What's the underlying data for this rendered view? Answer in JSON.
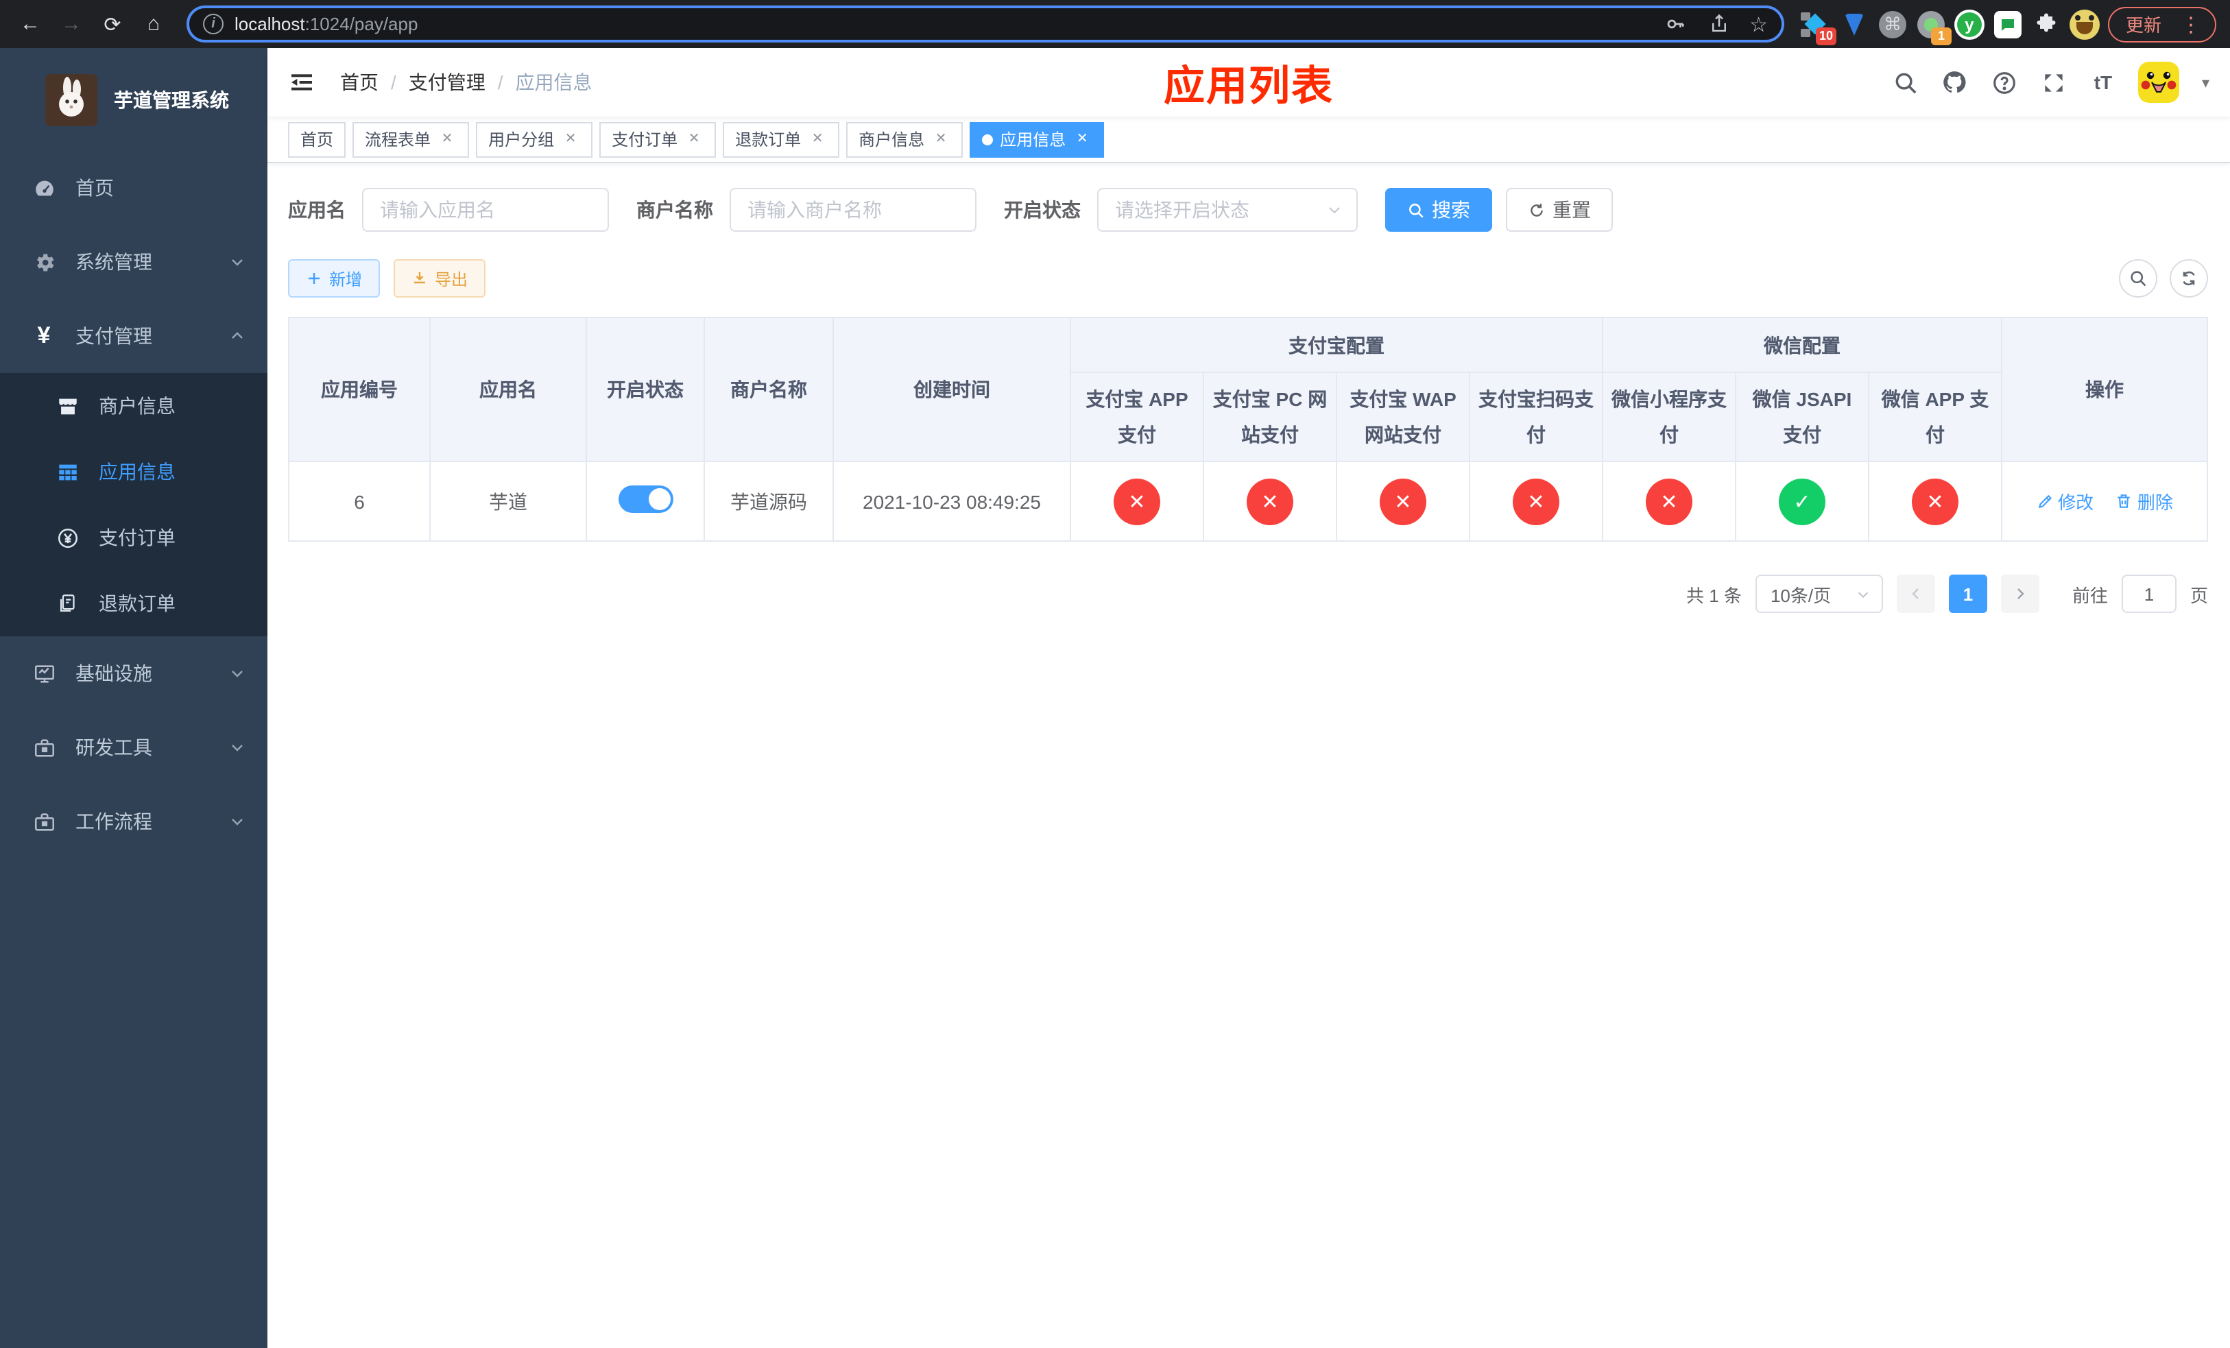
{
  "colors": {
    "primary": "#409eff",
    "success": "#13ce66",
    "danger": "#f8413d",
    "warning": "#e6a23c",
    "sidebar_bg": "#304156",
    "submenu_bg": "#1f2d3d",
    "page_title_red": "#ff2b00",
    "browser_bg": "#202124"
  },
  "icons": {
    "close": "✕",
    "check": "✓",
    "back": "←",
    "forward": "→",
    "reload": "⟳",
    "home": "⌂",
    "command": "⌘",
    "star": "☆",
    "menu_dots": "⋮",
    "caret_down": "▾",
    "font_size": "tT",
    "question": "?",
    "ext_y": "y"
  },
  "browser": {
    "url_host": "localhost",
    "url_path": ":1024/pay/app",
    "update_label": "更新",
    "ext_badges": [
      "10",
      "1"
    ]
  },
  "sidebar": {
    "title": "芋道管理系统",
    "items": [
      {
        "label": "首页"
      },
      {
        "label": "系统管理"
      },
      {
        "label": "支付管理"
      },
      {
        "label": "基础设施"
      },
      {
        "label": "研发工具"
      },
      {
        "label": "工作流程"
      }
    ],
    "submenu": [
      {
        "label": "商户信息"
      },
      {
        "label": "应用信息"
      },
      {
        "label": "支付订单"
      },
      {
        "label": "退款订单"
      }
    ]
  },
  "navbar": {
    "breadcrumb": [
      "首页",
      "支付管理",
      "应用信息"
    ],
    "page_title": "应用列表"
  },
  "tabs": [
    {
      "label": "首页"
    },
    {
      "label": "流程表单"
    },
    {
      "label": "用户分组"
    },
    {
      "label": "支付订单"
    },
    {
      "label": "退款订单"
    },
    {
      "label": "商户信息"
    },
    {
      "label": "应用信息"
    }
  ],
  "filter": {
    "app_name_label": "应用名",
    "app_name_placeholder": "请输入应用名",
    "merchant_label": "商户名称",
    "merchant_placeholder": "请输入商户名称",
    "status_label": "开启状态",
    "status_placeholder": "请选择开启状态",
    "search_label": "搜索",
    "reset_label": "重置"
  },
  "toolbar": {
    "add_label": "新增",
    "export_label": "导出"
  },
  "table": {
    "columns": [
      "应用编号",
      "应用名",
      "开启状态",
      "商户名称",
      "创建时间"
    ],
    "groups": [
      "支付宝配置",
      "微信配置"
    ],
    "channel_columns": [
      "支付宝 APP 支付",
      "支付宝 PC 网站支付",
      "支付宝 WAP 网站支付",
      "支付宝扫码支付",
      "微信小程序支付",
      "微信 JSAPI 支付",
      "微信 APP 支付"
    ],
    "actions_column": "操作",
    "row": {
      "id": "6",
      "name": "芋道",
      "enabled": true,
      "merchant": "芋道源码",
      "created_at": "2021-10-23 08:49:25",
      "channels": [
        false,
        false,
        false,
        false,
        false,
        true,
        false
      ],
      "edit_label": "修改",
      "delete_label": "删除"
    }
  },
  "pagination": {
    "total": "共 1 条",
    "page_size": "10条/页",
    "current_page": "1",
    "goto_prefix": "前往",
    "goto_value": "1",
    "goto_suffix": "页"
  }
}
